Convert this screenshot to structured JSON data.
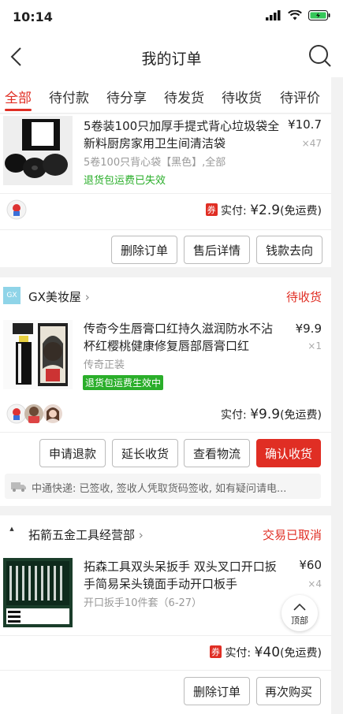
{
  "status_bar": {
    "time": "10:14"
  },
  "nav": {
    "title": "我的订单"
  },
  "tabs": [
    "全部",
    "待付款",
    "待分享",
    "待发货",
    "待收货",
    "待评价"
  ],
  "orders": [
    {
      "item": {
        "title": "5卷装100只加厚手提式背心垃圾袋全新料厨房家用卫生间清洁袋",
        "price": "¥10.7",
        "qty": "×47",
        "sku": "5卷100只背心袋【黑色】,全部",
        "tag": "退货包运费已失效"
      },
      "paid_label": "实付:",
      "paid_amount": "¥2.9",
      "shipping_note": "(免运费)",
      "coupon": "券",
      "buttons": [
        "删除订单",
        "售后详情",
        "钱款去向"
      ]
    },
    {
      "shop": "GX美妆屋",
      "shop_logo": "GX",
      "status": "待收货",
      "item": {
        "title": "传奇今生唇膏口红持久滋润防水不沾杯红樱桃健康修复唇部唇膏口红",
        "price": "¥9.9",
        "qty": "×1",
        "sku": "传奇正装",
        "tag": "退货包运费生效中"
      },
      "paid_label": "实付:",
      "paid_amount": "¥9.9",
      "shipping_note": "(免运费)",
      "buttons": [
        "申请退款",
        "延长收货",
        "查看物流",
        "确认收货"
      ],
      "shipping_info": "中通快递: 已签收, 签收人凭取货码签收, 如有疑问请电..."
    },
    {
      "shop": "拓箭五金工具经营部",
      "status": "交易已取消",
      "item": {
        "title": "拓森工具双头呆扳手 双头叉口开口扳手简易呆头镜面手动开口板手",
        "price": "¥60",
        "qty": "×4",
        "sku": "开口扳手10件套（6-27）"
      },
      "paid_label": "实付:",
      "paid_amount": "¥40",
      "shipping_note": "(免运费)",
      "coupon": "券",
      "buttons": [
        "删除订单",
        "再次购买"
      ]
    }
  ],
  "back_to_top": "顶部",
  "colors": {
    "accent": "#e02e24",
    "green": "#2aae2a"
  }
}
